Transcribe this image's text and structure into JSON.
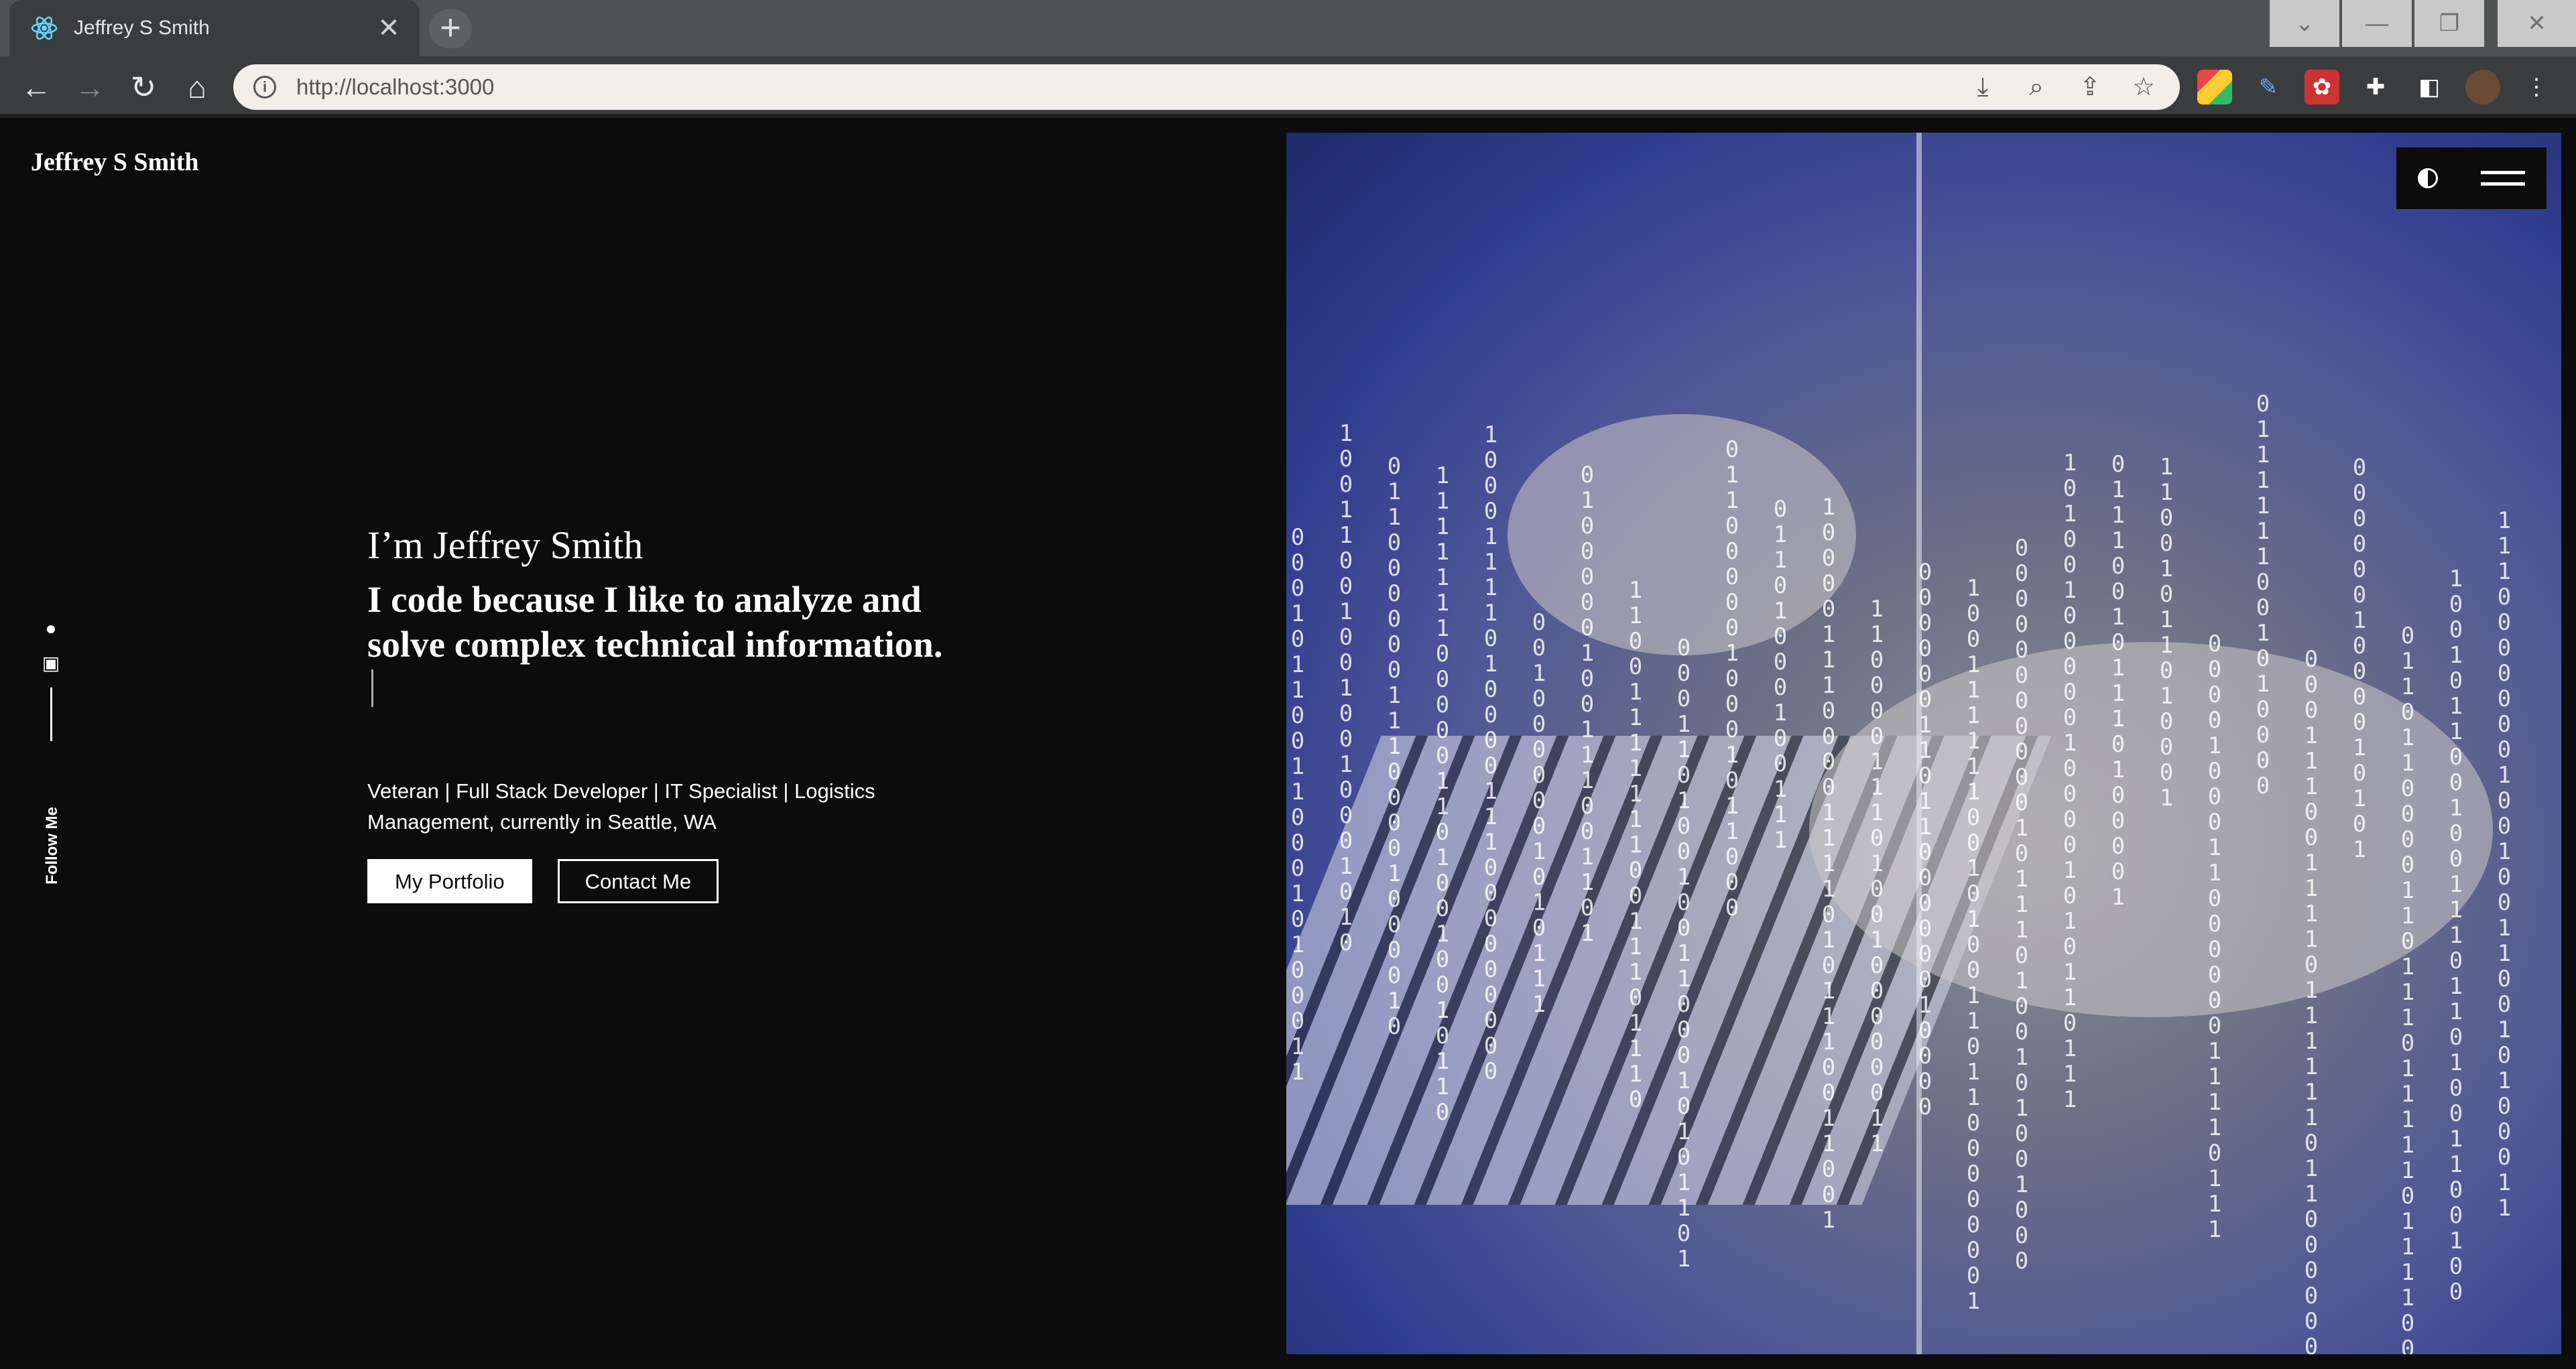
{
  "browser": {
    "tab_title": "Jeffrey S Smith",
    "url": "http://localhost:3000",
    "new_tab_label": "+",
    "tab_close_label": "✕"
  },
  "site": {
    "brand": "Jeffrey S Smith",
    "intro": "I’m Jeffrey Smith",
    "headline": "I code because I like to analyze and solve complex technical information.",
    "bio": "Veteran | Full Stack Developer | IT Specialist | Logistics Management, currently in Seattle, WA",
    "buttons": {
      "portfolio": "My Portfolio",
      "contact": "Contact Me"
    },
    "follow_label": "Follow Me"
  },
  "colors": {
    "page_bg": "#0c0c0c",
    "text": "#ffffff",
    "chrome_dark": "#3b3c3e",
    "chrome_tabstrip": "#505152",
    "image_blue": "#303d8e"
  },
  "icons": {
    "social": [
      "github-icon",
      "linkedin-icon"
    ],
    "image_controls": [
      "contrast-icon",
      "menu-icon"
    ]
  }
}
